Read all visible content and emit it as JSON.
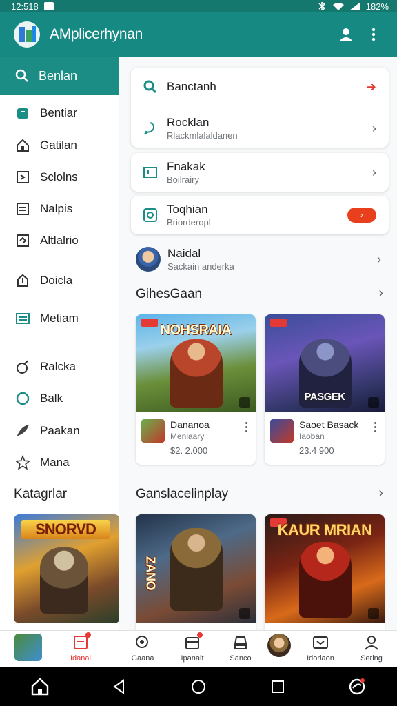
{
  "status_bar": {
    "time": "12:518",
    "battery": "182%"
  },
  "app_bar": {
    "title": "AMplicerhynan"
  },
  "sidebar": {
    "search_label": "Benlan",
    "items": [
      {
        "label": "Bentiar",
        "icon": "bag-icon"
      },
      {
        "label": "Gatilan",
        "icon": "home-icon"
      },
      {
        "label": "Sclolns",
        "icon": "document-icon"
      },
      {
        "label": "Nalpis",
        "icon": "list-icon"
      },
      {
        "label": "Altlalrio",
        "icon": "inbox-icon"
      },
      {
        "label": "Doicla",
        "icon": "upload-icon"
      },
      {
        "label": "Metiam",
        "icon": "card-icon"
      },
      {
        "label": "Ralcka",
        "icon": "grenade-icon"
      },
      {
        "label": "Balk",
        "icon": "circle-icon"
      },
      {
        "label": "Paakan",
        "icon": "feather-icon"
      },
      {
        "label": "Mana",
        "icon": "star-icon"
      }
    ],
    "section_title": "Katagrlar",
    "promo_title": "SNORVD"
  },
  "main": {
    "search_card": {
      "search_label": "Banctanh",
      "row2_title": "Rocklan",
      "row2_sub": "Rlackmlalaldanen"
    },
    "card2": {
      "title": "Fnakak",
      "sub": "Boilrairy"
    },
    "card3": {
      "title": "Toqhian",
      "sub": "Briorderopl"
    },
    "profile": {
      "name": "Naidal",
      "sub": "Sackain anderka"
    },
    "section1_title": "GihesGaan",
    "section2_title": "Ganslacelinplay",
    "games": [
      {
        "art_title": "NOHSRAIA",
        "name": "Dananoa",
        "dev": "Menlaary",
        "price": "$2. 2.000"
      },
      {
        "art_title": "PASGEK",
        "name": "Saoet Basack",
        "dev": "Iaoban",
        "price": "23.4 900"
      },
      {
        "art_title": "ZANO",
        "name": "",
        "dev": "",
        "price": ""
      },
      {
        "art_title": "KAUR MRIAN",
        "name": "",
        "dev": "",
        "price": ""
      }
    ]
  },
  "bottom_nav": {
    "items": [
      {
        "label": "",
        "icon": "app-thumbnail"
      },
      {
        "label": "Idanal",
        "icon": "note-icon",
        "active": true
      },
      {
        "label": "Gaana",
        "icon": "search-icon"
      },
      {
        "label": "Ipanait",
        "icon": "gift-icon"
      },
      {
        "label": "Sanco",
        "icon": "person-icon"
      },
      {
        "label": "",
        "icon": "avatar"
      },
      {
        "label": "Idorlaon",
        "icon": "tv-icon"
      },
      {
        "label": "Sering",
        "icon": "profile-icon"
      }
    ]
  },
  "colors": {
    "primary": "#168a82",
    "accent": "#e8401c",
    "surface": "#ffffff"
  }
}
